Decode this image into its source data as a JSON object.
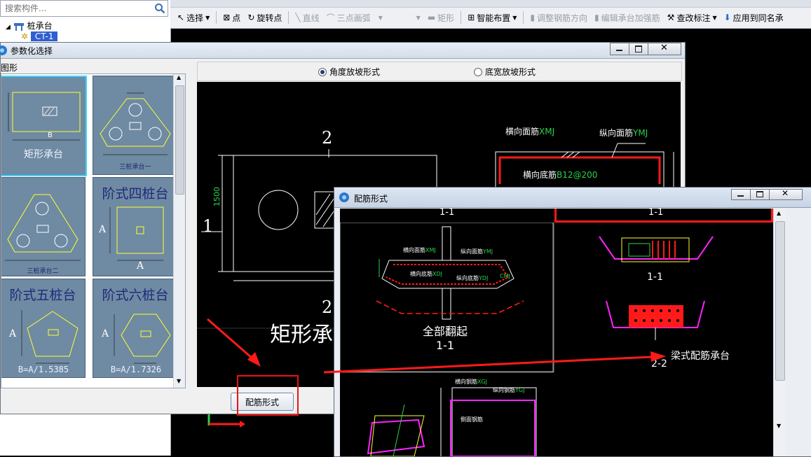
{
  "search": {
    "placeholder": "搜索构件..."
  },
  "tree": {
    "root": "桩承台",
    "child": "CT-1"
  },
  "toolbar": {
    "items": [
      "选择",
      "点",
      "旋转点",
      "直线",
      "三点画弧",
      "矩形",
      "智能布置",
      "调整钢筋方向",
      "编辑承台加强筋",
      "查改标注",
      "应用到同名承"
    ],
    "enabled": [
      true,
      true,
      true,
      false,
      false,
      false,
      true,
      false,
      false,
      true,
      true
    ]
  },
  "param_dialog": {
    "title": "参数化选择",
    "group_label": "图形",
    "radio_angle": "角度放坡形式",
    "radio_width": "底宽放坡形式",
    "confirm_button": "配筋形式",
    "thumbs": {
      "rect": "矩形承台",
      "dim_b": "B",
      "three1": "三桩承台一",
      "three2": "三桩承台二",
      "step4": "阶式四桩台",
      "step5": "阶式五桩台",
      "step6": "阶式六桩台",
      "dim_a": "A",
      "foot5": "B=A/1.5385",
      "foot6": "B=A/1.7326"
    },
    "preview": {
      "label_1": "1",
      "label_2_top": "2",
      "label_2_bottom": "2",
      "dim_1500": "1500",
      "title_partial": "矩形承",
      "xmj_label": "横向面筋",
      "xmj_code": "XMJ",
      "ymj_label": "纵向面筋",
      "ymj_code": "YMJ",
      "bottom_label": "横向底筋",
      "bottom_code": "B12@200",
      "section": "1-1"
    }
  },
  "rebar_dialog": {
    "title": "配筋形式",
    "options": [
      {
        "label": "全部翻起",
        "section": "1-1"
      },
      {
        "label": "梁式配筋承台",
        "section": "1-1"
      }
    ],
    "sections": {
      "s11": "1-1",
      "s22": "2-2"
    },
    "annot": {
      "xmj": "横向面筋",
      "ymj": "纵向面筋",
      "xdj": "横向底筋",
      "ydj": "纵向底筋",
      "xgj": "横向钢筋",
      "ygj": "纵向钢筋",
      "ce": "侧面钢筋",
      "code_xmj": "XMJ",
      "code_ymj": "YMJ",
      "code_xdj": "XDJ",
      "code_ydj": "YDJ",
      "code_xgj": "XGJ",
      "code_ygj": "YGJ",
      "code_cmj": "CMJ"
    }
  },
  "colors": {
    "accent_red": "#ff1a1a",
    "cad_green": "#29d44a",
    "cad_magenta": "#ff22ff",
    "cad_yellow": "#ffff30"
  }
}
